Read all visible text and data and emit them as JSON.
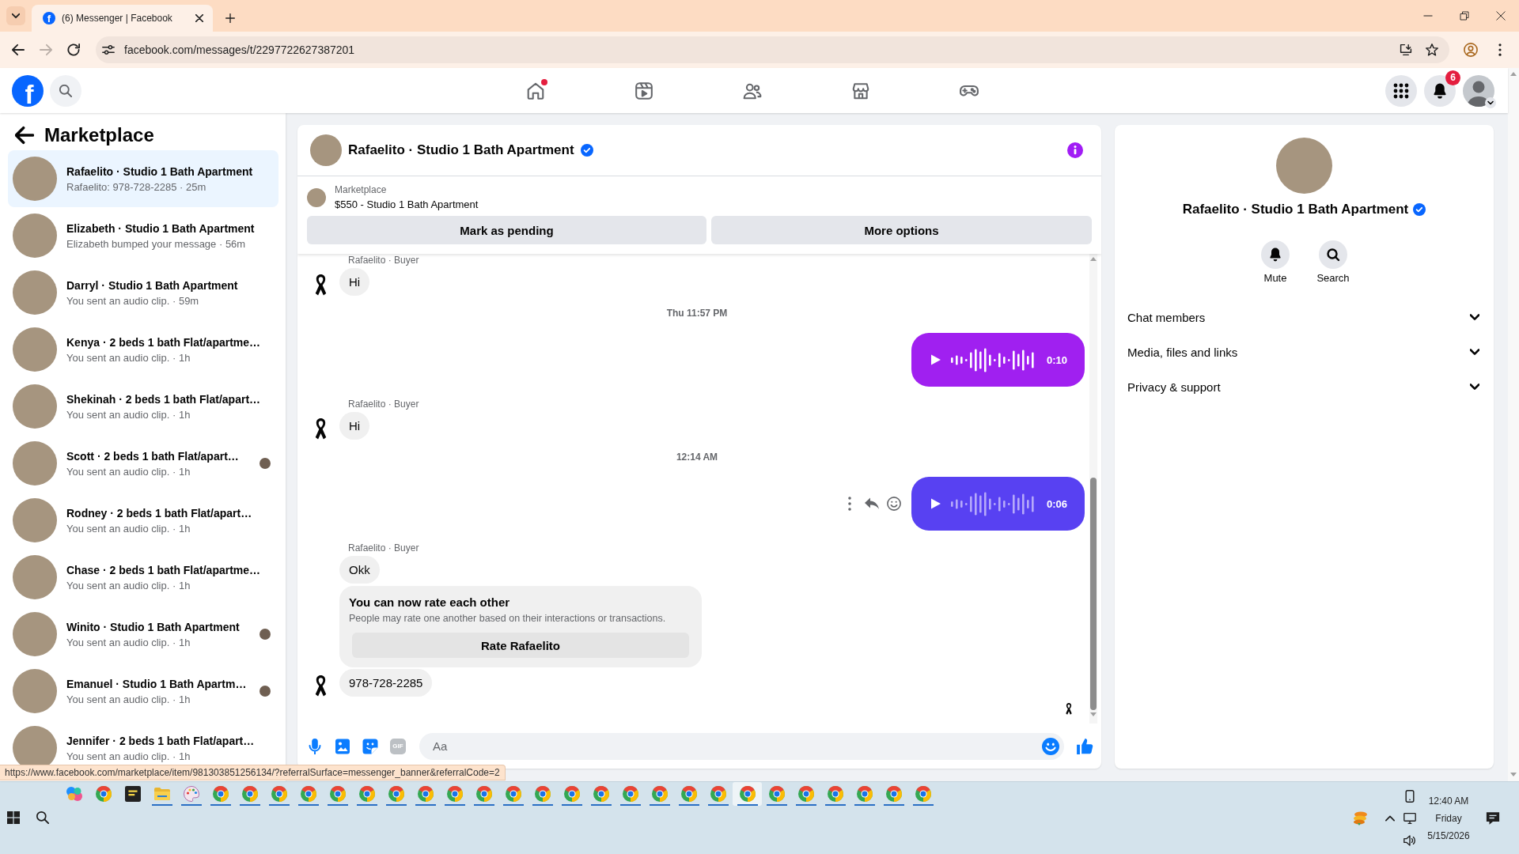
{
  "browser": {
    "tab": {
      "icon": "f",
      "title": "(6) Messenger | Facebook"
    },
    "nav": [
      {
        "kind": "back",
        "disabled": false
      },
      {
        "kind": "forward",
        "disabled": true
      },
      {
        "kind": "reload",
        "disabled": false
      }
    ],
    "url": "facebook.com/messages/t/2297722627387201",
    "status_url": "https://www.facebook.com/marketplace/item/981303851256134/?referralSurface=messenger_banner&referralCode=2"
  },
  "topnav": {
    "logo": "f",
    "items": [
      {
        "kind": "home",
        "selected": false,
        "dot": true
      },
      {
        "kind": "video",
        "selected": false,
        "dot": false
      },
      {
        "kind": "friends",
        "selected": false,
        "dot": false
      },
      {
        "kind": "marketplace",
        "selected": false,
        "dot": false
      },
      {
        "kind": "gaming",
        "selected": false,
        "dot": false
      }
    ],
    "notifications_badge": "6"
  },
  "sidebar": {
    "title": "Marketplace",
    "conversations": [
      {
        "title": "Rafaelito · Studio 1 Bath Apartment",
        "preview": "Rafaelito: 978-728-2285 · 25m",
        "selected": true,
        "seen": false
      },
      {
        "title": "Elizabeth · Studio 1 Bath Apartment",
        "preview": "Elizabeth bumped your message · 56m",
        "selected": false,
        "seen": false
      },
      {
        "title": "Darryl · Studio 1 Bath Apartment",
        "preview": "You sent an audio clip. · 59m",
        "selected": false,
        "seen": false
      },
      {
        "title": "Kenya · 2 beds 1 bath Flat/apartme…",
        "preview": "You sent an audio clip. · 1h",
        "selected": false,
        "seen": false
      },
      {
        "title": "Shekinah · 2 beds 1 bath Flat/apart…",
        "preview": "You sent an audio clip. · 1h",
        "selected": false,
        "seen": false
      },
      {
        "title": "Scott · 2 beds 1 bath Flat/apart…",
        "preview": "You sent an audio clip. · 1h",
        "selected": false,
        "seen": true
      },
      {
        "title": "Rodney · 2 beds 1 bath Flat/apart…",
        "preview": "You sent an audio clip. · 1h",
        "selected": false,
        "seen": false
      },
      {
        "title": "Chase · 2 beds 1 bath Flat/apartme…",
        "preview": "You sent an audio clip. · 1h",
        "selected": false,
        "seen": false
      },
      {
        "title": "Winito · Studio 1 Bath Apartment",
        "preview": "You sent an audio clip. · 1h",
        "selected": false,
        "seen": true
      },
      {
        "title": "Emanuel · Studio 1 Bath Apartm…",
        "preview": "You sent an audio clip. · 1h",
        "selected": false,
        "seen": true
      },
      {
        "title": "Jennifer · 2 beds 1 bath Flat/apart…",
        "preview": "You sent an audio clip. · 1h",
        "selected": false,
        "seen": false
      }
    ]
  },
  "chat": {
    "title": "Rafaelito · Studio 1 Bath Apartment",
    "verified": true,
    "banner": {
      "label": "Marketplace",
      "listing": "$550 - Studio 1 Bath Apartment",
      "buttons": [
        "Mark as pending",
        "More options"
      ]
    },
    "messages": [
      {
        "kind": "sender",
        "text": "Rafaelito · Buyer"
      },
      {
        "kind": "text",
        "text": "Hi",
        "avatar": true
      },
      {
        "kind": "time",
        "text": "Thu 11:57 PM"
      },
      {
        "kind": "audio",
        "duration": "0:10",
        "color": "#a020f0",
        "played": true,
        "actions": false
      },
      {
        "kind": "sender",
        "text": "Rafaelito · Buyer"
      },
      {
        "kind": "text",
        "text": "Hi",
        "avatar": true
      },
      {
        "kind": "time",
        "text": "12:14 AM"
      },
      {
        "kind": "audio",
        "duration": "0:06",
        "color": "#5841f2",
        "played": false,
        "actions": true
      },
      {
        "kind": "sender",
        "text": "Rafaelito · Buyer"
      },
      {
        "kind": "text",
        "text": "Okk",
        "avatar": false
      },
      {
        "kind": "rating",
        "title": "You can now rate each other",
        "body": "People may rate one another based on their interactions or transactions.",
        "button": "Rate Rafaelito"
      },
      {
        "kind": "text",
        "text": "978-728-2285",
        "avatar": true
      }
    ],
    "seen": true,
    "composer": {
      "tools": [
        {
          "kind": "mic",
          "disabled": false
        },
        {
          "kind": "image",
          "disabled": false
        },
        {
          "kind": "sticker",
          "disabled": false
        },
        {
          "kind": "gif",
          "label": "GIF",
          "disabled": true
        }
      ],
      "placeholder": "Aa"
    }
  },
  "details": {
    "name": "Rafaelito · Studio 1 Bath Apartment",
    "verified": true,
    "actions": [
      {
        "kind": "mute",
        "label": "Mute"
      },
      {
        "kind": "search",
        "label": "Search"
      }
    ],
    "sections": [
      {
        "label": "Chat members",
        "expanded": false
      },
      {
        "label": "Media, files and links",
        "expanded": false
      },
      {
        "label": "Privacy & support",
        "expanded": false
      }
    ]
  },
  "taskbar": {
    "apps": [
      {
        "kind": "copilot",
        "running": false,
        "selected": false
      },
      {
        "kind": "chrome",
        "running": false,
        "selected": false
      },
      {
        "kind": "notes",
        "running": false,
        "selected": false
      },
      {
        "kind": "explorer",
        "running": true,
        "selected": false
      },
      {
        "kind": "paint",
        "running": true,
        "selected": false
      },
      {
        "kind": "chrome",
        "running": true,
        "selected": false
      },
      {
        "kind": "chrome",
        "running": true,
        "selected": false
      },
      {
        "kind": "chrome",
        "running": true,
        "selected": false
      },
      {
        "kind": "chrome",
        "running": true,
        "selected": false
      },
      {
        "kind": "chrome",
        "running": true,
        "selected": false
      },
      {
        "kind": "chrome",
        "running": true,
        "selected": false
      },
      {
        "kind": "chrome",
        "running": true,
        "selected": false
      },
      {
        "kind": "chrome",
        "running": true,
        "selected": false
      },
      {
        "kind": "chrome",
        "running": true,
        "selected": false
      },
      {
        "kind": "chrome",
        "running": true,
        "selected": false
      },
      {
        "kind": "chrome",
        "running": true,
        "selected": false
      },
      {
        "kind": "chrome",
        "running": true,
        "selected": false
      },
      {
        "kind": "chrome",
        "running": true,
        "selected": false
      },
      {
        "kind": "chrome",
        "running": true,
        "selected": false
      },
      {
        "kind": "chrome",
        "running": true,
        "selected": false
      },
      {
        "kind": "chrome",
        "running": true,
        "selected": false
      },
      {
        "kind": "chrome",
        "running": true,
        "selected": false
      },
      {
        "kind": "chrome",
        "running": true,
        "selected": false
      },
      {
        "kind": "chrome",
        "running": true,
        "selected": true
      },
      {
        "kind": "chrome",
        "running": true,
        "selected": false
      },
      {
        "kind": "chrome",
        "running": true,
        "selected": false
      },
      {
        "kind": "chrome",
        "running": true,
        "selected": false
      },
      {
        "kind": "chrome",
        "running": true,
        "selected": false
      },
      {
        "kind": "chrome",
        "running": true,
        "selected": false
      },
      {
        "kind": "chrome",
        "running": true,
        "selected": false
      }
    ],
    "clock": {
      "time": "12:40 AM",
      "day": "Friday",
      "date": "5/15/2026"
    }
  }
}
